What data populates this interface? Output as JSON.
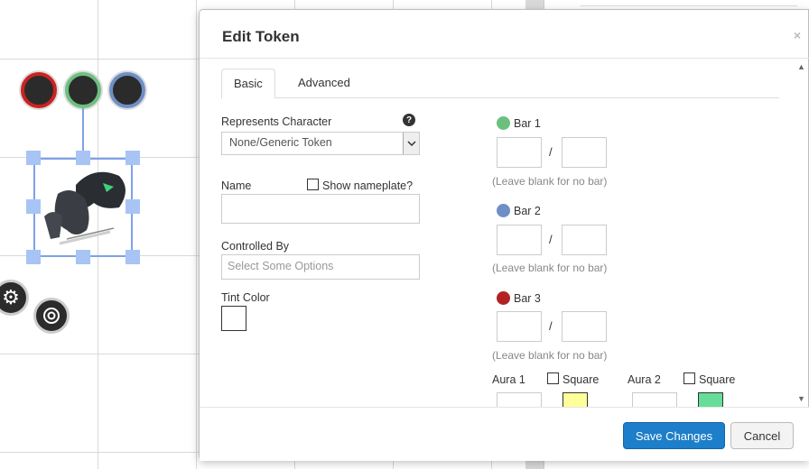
{
  "dialog": {
    "title": "Edit Token",
    "close_glyph": "×",
    "tabs": [
      {
        "label": "Basic",
        "active": true
      },
      {
        "label": "Advanced",
        "active": false
      }
    ]
  },
  "basic": {
    "represents_label": "Represents Character",
    "represents_value": "None/Generic Token",
    "help_glyph": "?",
    "name_label": "Name",
    "name_value": "",
    "show_nameplate_label": "Show nameplate?",
    "show_nameplate_checked": false,
    "controlled_by_label": "Controlled By",
    "controlled_by_placeholder": "Select Some Options",
    "tint_color_label": "Tint Color"
  },
  "bars": [
    {
      "label": "Bar 1",
      "color": "#6cc07e",
      "value": "",
      "max": "",
      "hint": "(Leave blank for no bar)"
    },
    {
      "label": "Bar 2",
      "color": "#6f8fc6",
      "value": "",
      "max": "",
      "hint": "(Leave blank for no bar)"
    },
    {
      "label": "Bar 3",
      "color": "#b22222",
      "value": "",
      "max": "",
      "hint": "(Leave blank for no bar)"
    }
  ],
  "bar_separator": "/",
  "auras": [
    {
      "label": "Aura 1",
      "square_label": "Square",
      "color": "#ffff99"
    },
    {
      "label": "Aura 2",
      "square_label": "Square",
      "color": "#66dd99"
    }
  ],
  "footer": {
    "save_label": "Save Changes",
    "cancel_label": "Cancel"
  },
  "canvas": {
    "status_colors": [
      "#cc2222",
      "#6cc07e",
      "#6f8fc6"
    ],
    "gear_glyph": "⚙",
    "selection_color": "#7da2e8"
  }
}
